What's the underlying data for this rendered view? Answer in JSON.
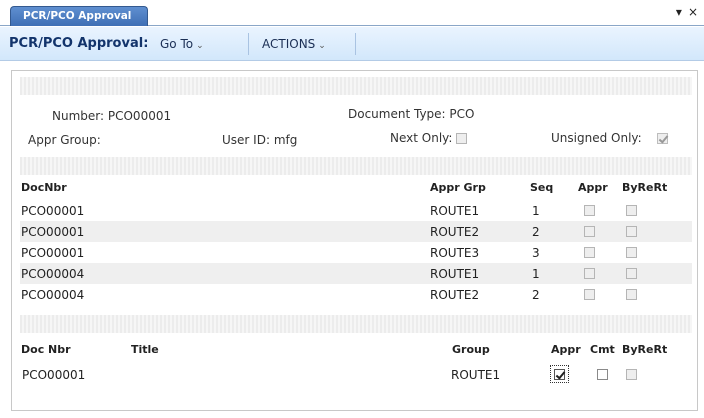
{
  "tab": {
    "label": "PCR/PCO Approval"
  },
  "window_controls": {
    "menu": "▾",
    "close": "×"
  },
  "toolbar": {
    "title": "PCR/PCO Approval:",
    "goto_label": "Go To",
    "actions_label": "ACTIONS",
    "chevron": "⌄"
  },
  "form": {
    "number_label": "Number:",
    "number_value": "PCO00001",
    "doc_type_label": "Document Type:",
    "doc_type_value": "PCO",
    "appr_group_label": "Appr Group:",
    "appr_group_value": "",
    "user_id_label": "User ID:",
    "user_id_value": "mfg",
    "next_only_label": "Next Only:",
    "next_only_checked": false,
    "unsigned_only_label": "Unsigned Only:",
    "unsigned_only_checked": true
  },
  "grid1": {
    "headers": {
      "docnbr": "DocNbr",
      "appr_grp": "Appr Grp",
      "seq": "Seq",
      "appr": "Appr",
      "byrert": "ByReRt"
    },
    "rows": [
      {
        "docnbr": "PCO00001",
        "appr_grp": "ROUTE1",
        "seq": "1",
        "appr": false,
        "byrert": false
      },
      {
        "docnbr": "PCO00001",
        "appr_grp": "ROUTE2",
        "seq": "2",
        "appr": false,
        "byrert": false
      },
      {
        "docnbr": "PCO00001",
        "appr_grp": "ROUTE3",
        "seq": "3",
        "appr": false,
        "byrert": false
      },
      {
        "docnbr": "PCO00004",
        "appr_grp": "ROUTE1",
        "seq": "1",
        "appr": false,
        "byrert": false
      },
      {
        "docnbr": "PCO00004",
        "appr_grp": "ROUTE2",
        "seq": "2",
        "appr": false,
        "byrert": false
      }
    ]
  },
  "grid2": {
    "headers": {
      "doc_nbr": "Doc Nbr",
      "title": "Title",
      "group": "Group",
      "appr": "Appr",
      "cmt": "Cmt",
      "byrert": "ByReRt"
    },
    "rows": [
      {
        "doc_nbr": "PCO00001",
        "title": "",
        "group": "ROUTE1",
        "appr": true,
        "cmt": false,
        "byrert": false
      }
    ]
  }
}
